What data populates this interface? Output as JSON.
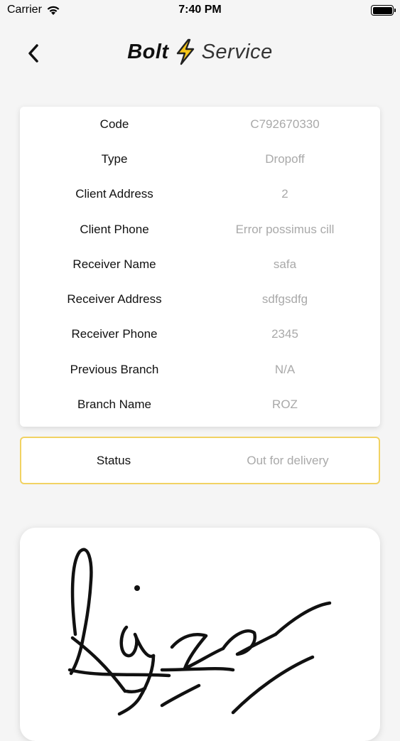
{
  "status_bar": {
    "carrier": "Carrier",
    "time": "7:40 PM"
  },
  "header": {
    "logo_bold": "Bolt",
    "logo_light": "Service",
    "back_icon": "chevron-left-icon",
    "bolt_icon": "lightning-icon",
    "bolt_color": "#f5c518"
  },
  "details": {
    "rows": [
      {
        "label": "Code",
        "value": "C792670330"
      },
      {
        "label": "Type",
        "value": "Dropoff"
      },
      {
        "label": "Client Address",
        "value": "2"
      },
      {
        "label": "Client Phone",
        "value": "Error possimus cill"
      },
      {
        "label": "Receiver Name",
        "value": "safa"
      },
      {
        "label": "Receiver Address",
        "value": "sdfgsdfg"
      },
      {
        "label": "Receiver Phone",
        "value": "2345"
      },
      {
        "label": "Previous Branch",
        "value": "N/A"
      },
      {
        "label": "Branch Name",
        "value": "ROZ"
      }
    ]
  },
  "status": {
    "label": "Status",
    "value": "Out for delivery",
    "border_color": "#f1d263"
  },
  "signature": {
    "icon": "signature-image"
  }
}
